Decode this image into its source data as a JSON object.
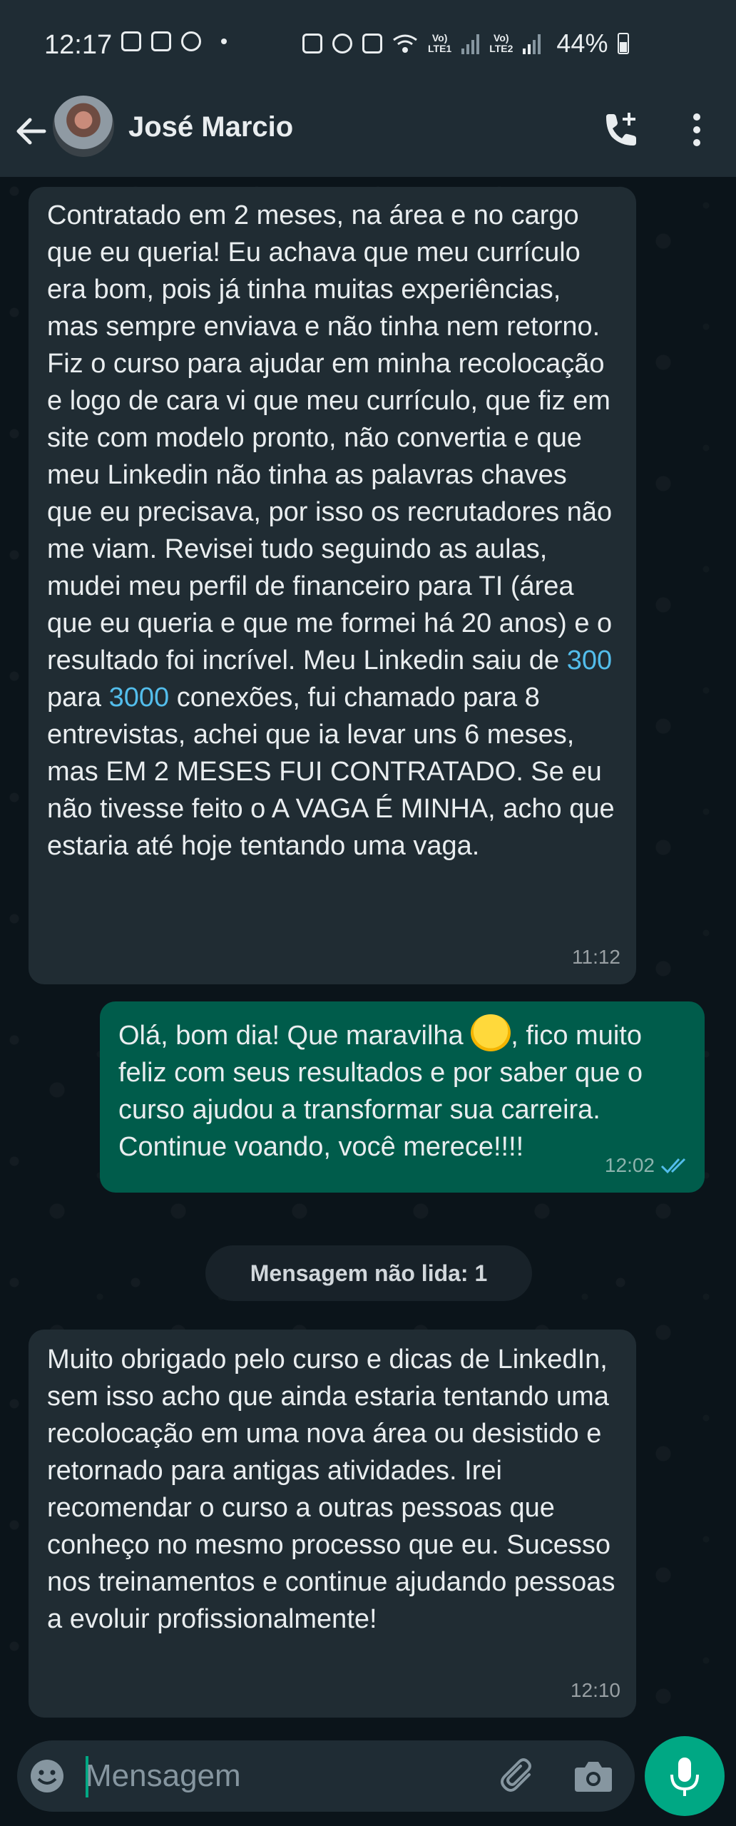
{
  "statusbar": {
    "time": "12:17",
    "lte1": "Vo)\nLTE1",
    "lte2": "Vo)\nLTE2",
    "battery": "44%"
  },
  "header": {
    "contact_name": "José Marcio"
  },
  "messages": [
    {
      "direction": "in",
      "text_parts": [
        "Contratado em 2 meses, na área e no cargo que eu queria! Eu achava que meu currículo era bom, pois já tinha muitas experiências, mas sempre enviava e não tinha nem retorno. Fiz o curso para ajudar em minha recolocação e logo de cara vi que meu currículo, que fiz em site com modelo pronto, não convertia e que meu Linkedin não tinha as palavras chaves que eu precisava, por isso os recrutadores não me viam. Revisei tudo seguindo as aulas, mudei meu perfil de financeiro para TI (área que eu queria e que me formei há 20 anos) e o resultado foi incrível. Meu Linkedin saiu de ",
        "300",
        " para ",
        "3000",
        " conexões, fui chamado para 8 entrevistas, achei que ia levar uns 6 meses, mas EM 2 MESES FUI CONTRATADO. Se eu não tivesse feito o A VAGA É MINHA, acho que estaria até hoje tentando uma vaga."
      ],
      "time": "11:12"
    },
    {
      "direction": "out",
      "text_before_emoji": "Olá, bom dia! Que maravilha ",
      "emoji_icon": "star-struck-emoji",
      "text_after_emoji": ", fico muito feliz com seus resultados e por saber que o curso ajudou a transformar sua carreira. Continue voando, você merece!!!!",
      "time": "12:02",
      "status": "read"
    },
    {
      "direction": "in",
      "text": "Muito obrigado pelo curso e dicas de LinkedIn, sem isso acho que ainda estaria tentando uma recolocação em uma nova área ou desistido e retornado para antigas atividades. Irei recomendar o curso a outras pessoas que conheço no mesmo processo que eu. Sucesso nos treinamentos e continue ajudando pessoas a evoluir profissionalmente!",
      "time": "12:10"
    }
  ],
  "unread_label": "Mensagem não lida: 1",
  "composer": {
    "placeholder": "Mensagem"
  },
  "colors": {
    "header_bg": "#1f2c34",
    "chat_bg": "#0b141a",
    "incoming_bubble": "#202c33",
    "outgoing_bubble": "#005c4b",
    "accent": "#00a884",
    "link": "#53bdeb"
  }
}
